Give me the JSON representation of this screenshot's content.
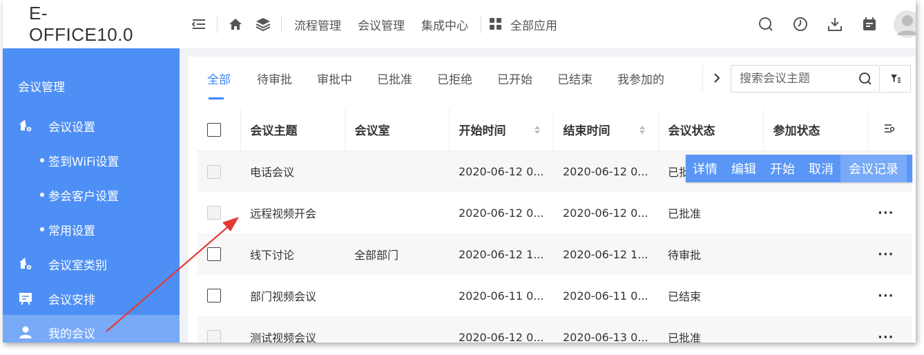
{
  "app": {
    "title": "E-OFFICE10.0"
  },
  "topnav": {
    "links": [
      "流程管理",
      "会议管理",
      "集成中心"
    ],
    "all_apps": "全部应用"
  },
  "sidebar": {
    "title": "会议管理",
    "items": [
      {
        "label": "会议设置",
        "icon": "house-gear-icon"
      },
      {
        "label": "签到WiFi设置",
        "sub": true
      },
      {
        "label": "参会客户设置",
        "sub": true
      },
      {
        "label": "常用设置",
        "sub": true
      },
      {
        "label": "会议室类别",
        "icon": "house-gear-icon"
      },
      {
        "label": "会议安排",
        "icon": "calendar-board-icon"
      },
      {
        "label": "我的会议",
        "icon": "person-icon",
        "active": true
      }
    ]
  },
  "tabs": [
    "全部",
    "待审批",
    "审批中",
    "已批准",
    "已拒绝",
    "已开始",
    "已结束",
    "我参加的"
  ],
  "search": {
    "placeholder": "搜索会议主题"
  },
  "table": {
    "columns": [
      "会议主题",
      "会议室",
      "开始时间",
      "结束时间",
      "会议状态",
      "参加状态"
    ],
    "rows": [
      {
        "subject": "电话会议",
        "room": "",
        "start": "2020-06-12 0...",
        "end": "2020-06-12 0...",
        "status": "已批",
        "join": ""
      },
      {
        "subject": "远程视频开会",
        "room": "",
        "start": "2020-06-12 0...",
        "end": "2020-06-12 0...",
        "status": "已批准",
        "join": ""
      },
      {
        "subject": "线下讨论",
        "room": "全部部门",
        "start": "2020-06-12 1...",
        "end": "2020-06-12 1...",
        "status": "待审批",
        "join": ""
      },
      {
        "subject": "部门视频会议",
        "room": "",
        "start": "2020-06-11 0...",
        "end": "2020-06-11 0...",
        "status": "已结束",
        "join": ""
      },
      {
        "subject": "测试视频会议",
        "room": "",
        "start": "2020-06-12 0...",
        "end": "2020-06-13 0...",
        "status": "已批准",
        "join": ""
      }
    ],
    "more": "···"
  },
  "row_actions": [
    "详情",
    "编辑",
    "开始",
    "取消",
    "会议记录"
  ],
  "colors": {
    "primary": "#4d8ff5",
    "active_tab": "#3d86f4",
    "arrow": "#e53935"
  }
}
